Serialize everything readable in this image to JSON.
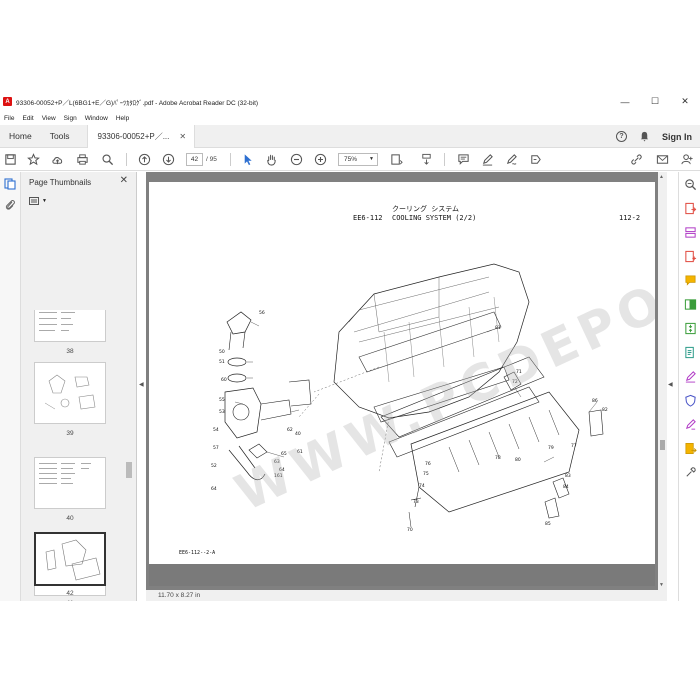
{
  "window": {
    "title": "93306-00052+P／L(6BG1+E／G)ﾊﾟｰﾂｶﾀﾛｸﾞ.pdf - Adobe Acrobat Reader DC (32-bit)",
    "minimize": "—",
    "maximize": "☐",
    "close": "✕"
  },
  "menu": [
    "File",
    "Edit",
    "View",
    "Sign",
    "Window",
    "Help"
  ],
  "tabs": {
    "home": "Home",
    "tools": "Tools",
    "document": "93306-00052+P／...",
    "close": "✕",
    "help": "?",
    "signin": "Sign In"
  },
  "toolbar": {
    "current_page": "42",
    "total_pages": "/ 95",
    "zoom": "75%"
  },
  "thumbnails": {
    "title": "Page Thumbnails",
    "close": "✕",
    "pages": [
      {
        "num": "38",
        "selected": false
      },
      {
        "num": "39",
        "selected": false
      },
      {
        "num": "40",
        "selected": false
      },
      {
        "num": "41",
        "selected": false
      },
      {
        "num": "42",
        "selected": true
      }
    ]
  },
  "document": {
    "code": "EE6-112",
    "title_jp": "クーリング システム",
    "title_en": "COOLING SYSTEM (2/2)",
    "page_ref": "112-2",
    "footer_code": "EE6-112--2-A",
    "watermark": "WWW.PCDEPO.COM",
    "part_numbers": [
      "56",
      "50",
      "51",
      "60",
      "55",
      "53",
      "54",
      "57",
      "52",
      "64",
      "63",
      "62",
      "161",
      "65",
      "64",
      "61",
      "40",
      "81",
      "71",
      "72",
      "86",
      "82",
      "80",
      "76",
      "75",
      "74",
      "73",
      "79",
      "78",
      "77",
      "70",
      "83",
      "84",
      "85",
      "38",
      "59"
    ]
  },
  "status": {
    "page_size": "11.70 x 8.27 in"
  },
  "colors": {
    "accent_blue": "#2d6fd1",
    "doc_background": "#808080"
  }
}
